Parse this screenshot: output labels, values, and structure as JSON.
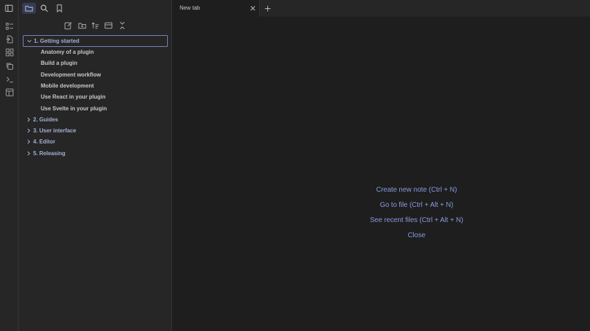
{
  "sidebar": {
    "tree": [
      {
        "label": "1. Getting started",
        "type": "folder",
        "expanded": true,
        "selected": true
      },
      {
        "label": "Anatomy of a plugin",
        "type": "file"
      },
      {
        "label": "Build a plugin",
        "type": "file"
      },
      {
        "label": "Development workflow",
        "type": "file"
      },
      {
        "label": "Mobile development",
        "type": "file"
      },
      {
        "label": "Use React in your plugin",
        "type": "file"
      },
      {
        "label": "Use Svelte in your plugin",
        "type": "file"
      },
      {
        "label": "2. Guides",
        "type": "folder",
        "expanded": false
      },
      {
        "label": "3. User interface",
        "type": "folder",
        "expanded": false
      },
      {
        "label": "4. Editor",
        "type": "folder",
        "expanded": false
      },
      {
        "label": "5. Releasing",
        "type": "folder",
        "expanded": false
      }
    ]
  },
  "tabs": [
    {
      "label": "New tab",
      "active": true
    }
  ],
  "main": {
    "actions": [
      "Create new note (Ctrl + N)",
      "Go to file (Ctrl + Alt + N)",
      "See recent files (Ctrl + Alt + N)",
      "Close"
    ]
  },
  "colors": {
    "accent": "#8a9de0",
    "folder_text": "#a6b0d4",
    "selected_border": "#7c86c0"
  }
}
